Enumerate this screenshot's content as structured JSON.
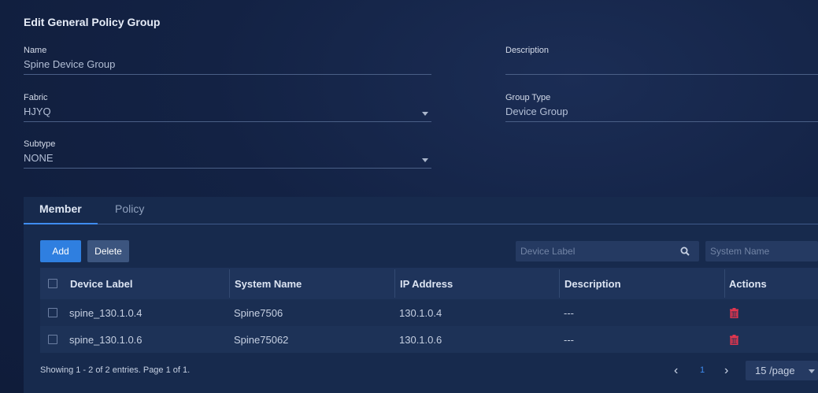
{
  "header": {
    "title": "Edit General Policy Group"
  },
  "form": {
    "name": {
      "label": "Name",
      "value": "Spine Device Group"
    },
    "description": {
      "label": "Description",
      "value": ""
    },
    "fabric": {
      "label": "Fabric",
      "value": "HJYQ"
    },
    "group_type": {
      "label": "Group Type",
      "value": "Device Group"
    },
    "subtype": {
      "label": "Subtype",
      "value": "NONE"
    }
  },
  "tabs": [
    {
      "label": "Member",
      "active": true
    },
    {
      "label": "Policy",
      "active": false
    }
  ],
  "toolbar": {
    "add_label": "Add",
    "delete_label": "Delete",
    "device_label_placeholder": "Device Label",
    "system_name_placeholder": "System Name"
  },
  "table": {
    "columns": [
      "Device Label",
      "System Name",
      "IP Address",
      "Description",
      "Actions"
    ],
    "rows": [
      {
        "device_label": "spine_130.1.0.4",
        "system_name": "Spine7506",
        "ip": "130.1.0.4",
        "description": "---"
      },
      {
        "device_label": "spine_130.1.0.6",
        "system_name": "Spine75062",
        "ip": "130.1.0.6",
        "description": "---"
      }
    ]
  },
  "pagination": {
    "summary": "Showing 1 - 2 of 2 entries. Page 1 of 1.",
    "prev": "‹",
    "current": "1",
    "next": "›",
    "page_size": "15 /page"
  },
  "colors": {
    "accent": "#3f8cf0",
    "delete_icon": "#e0364f",
    "background": "#132244"
  }
}
